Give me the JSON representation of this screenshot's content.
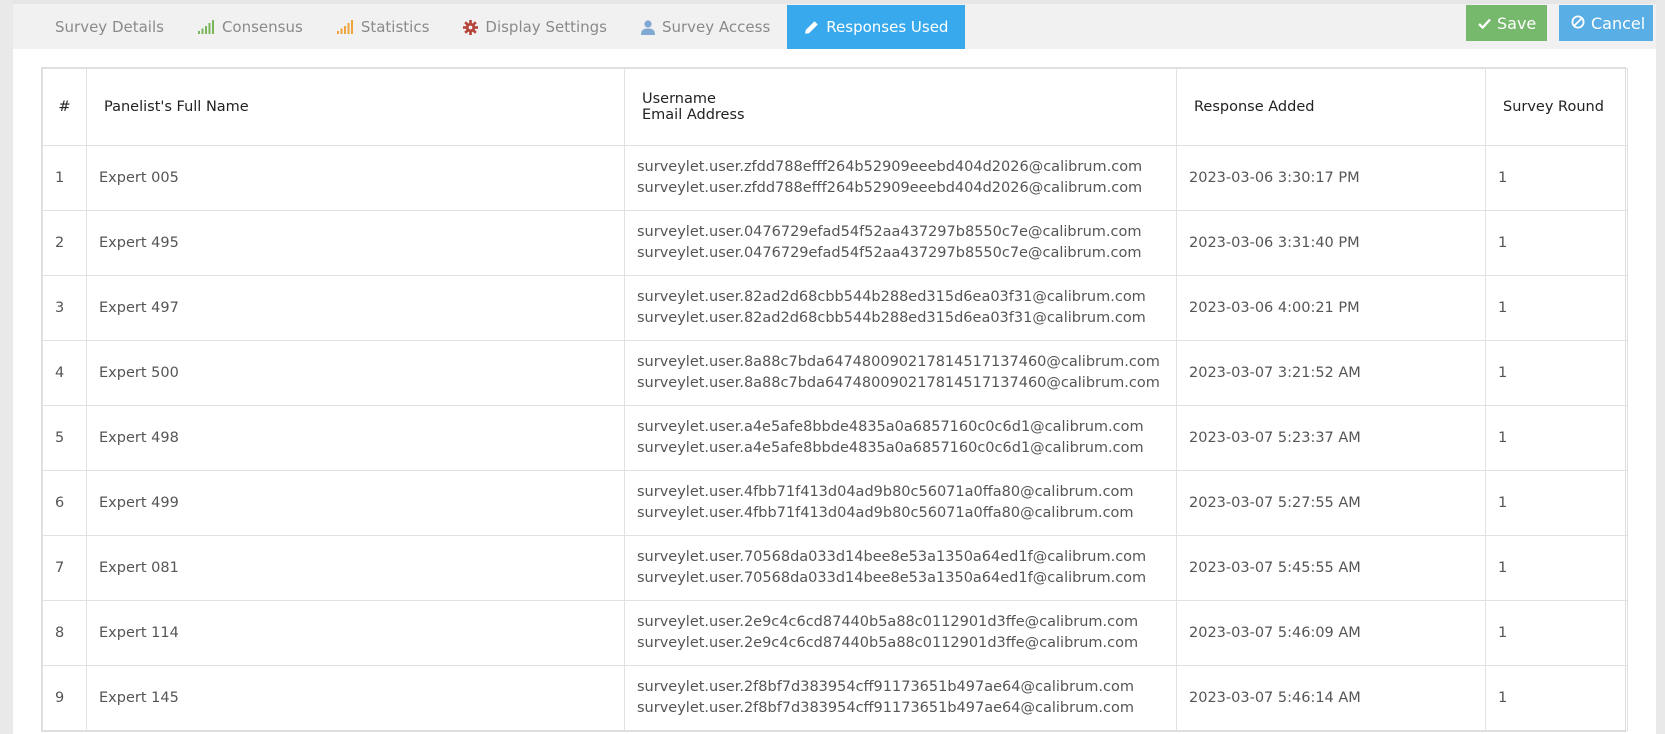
{
  "tabs": [
    {
      "label": "Survey Details",
      "icon": "none",
      "active": false
    },
    {
      "label": "Consensus",
      "icon": "signal-bars-green-icon",
      "active": false
    },
    {
      "label": "Statistics",
      "icon": "signal-bars-orange-icon",
      "active": false
    },
    {
      "label": "Display Settings",
      "icon": "gear-icon",
      "active": false
    },
    {
      "label": "Survey Access",
      "icon": "user-icon",
      "active": false
    },
    {
      "label": "Responses Used",
      "icon": "pencil-icon",
      "active": true
    }
  ],
  "actions": {
    "save_label": "Save",
    "cancel_label": "Cancel"
  },
  "colors": {
    "accent": "#38a9ec",
    "save": "#76b86c",
    "cancel": "#58aee5",
    "consensus_icon": "#7ab55c",
    "statistics_icon": "#f0a43c",
    "gear_icon": "#b5453b",
    "user_icon": "#7fa9d3"
  },
  "table": {
    "headers": {
      "num": "#",
      "name": "Panelist's Full Name",
      "username": "Username",
      "email": "Email Address",
      "added": "Response Added",
      "round": "Survey Round"
    },
    "rows": [
      {
        "num": "1",
        "name": "Expert 005",
        "username": "surveylet.user.zfdd788efff264b52909eeebd404d2026@calibrum.com",
        "email": "surveylet.user.zfdd788efff264b52909eeebd404d2026@calibrum.com",
        "added": "2023-03-06 3:30:17 PM",
        "round": "1"
      },
      {
        "num": "2",
        "name": "Expert 495",
        "username": "surveylet.user.0476729efad54f52aa437297b8550c7e@calibrum.com",
        "email": "surveylet.user.0476729efad54f52aa437297b8550c7e@calibrum.com",
        "added": "2023-03-06 3:31:40 PM",
        "round": "1"
      },
      {
        "num": "3",
        "name": "Expert 497",
        "username": "surveylet.user.82ad2d68cbb544b288ed315d6ea03f31@calibrum.com",
        "email": "surveylet.user.82ad2d68cbb544b288ed315d6ea03f31@calibrum.com",
        "added": "2023-03-06 4:00:21 PM",
        "round": "1"
      },
      {
        "num": "4",
        "name": "Expert 500",
        "username": "surveylet.user.8a88c7bda647480090217814517137460@calibrum.com",
        "email": "surveylet.user.8a88c7bda647480090217814517137460@calibrum.com",
        "added": "2023-03-07 3:21:52 AM",
        "round": "1"
      },
      {
        "num": "5",
        "name": "Expert 498",
        "username": "surveylet.user.a4e5afe8bbde4835a0a6857160c0c6d1@calibrum.com",
        "email": "surveylet.user.a4e5afe8bbde4835a0a6857160c0c6d1@calibrum.com",
        "added": "2023-03-07 5:23:37 AM",
        "round": "1"
      },
      {
        "num": "6",
        "name": "Expert 499",
        "username": "surveylet.user.4fbb71f413d04ad9b80c56071a0ffa80@calibrum.com",
        "email": "surveylet.user.4fbb71f413d04ad9b80c56071a0ffa80@calibrum.com",
        "added": "2023-03-07 5:27:55 AM",
        "round": "1"
      },
      {
        "num": "7",
        "name": "Expert 081",
        "username": "surveylet.user.70568da033d14bee8e53a1350a64ed1f@calibrum.com",
        "email": "surveylet.user.70568da033d14bee8e53a1350a64ed1f@calibrum.com",
        "added": "2023-03-07 5:45:55 AM",
        "round": "1"
      },
      {
        "num": "8",
        "name": "Expert 114",
        "username": "surveylet.user.2e9c4c6cd87440b5a88c0112901d3ffe@calibrum.com",
        "email": "surveylet.user.2e9c4c6cd87440b5a88c0112901d3ffe@calibrum.com",
        "added": "2023-03-07 5:46:09 AM",
        "round": "1"
      },
      {
        "num": "9",
        "name": "Expert 145",
        "username": "surveylet.user.2f8bf7d383954cff91173651b497ae64@calibrum.com",
        "email": "surveylet.user.2f8bf7d383954cff91173651b497ae64@calibrum.com",
        "added": "2023-03-07 5:46:14 AM",
        "round": "1"
      }
    ]
  }
}
